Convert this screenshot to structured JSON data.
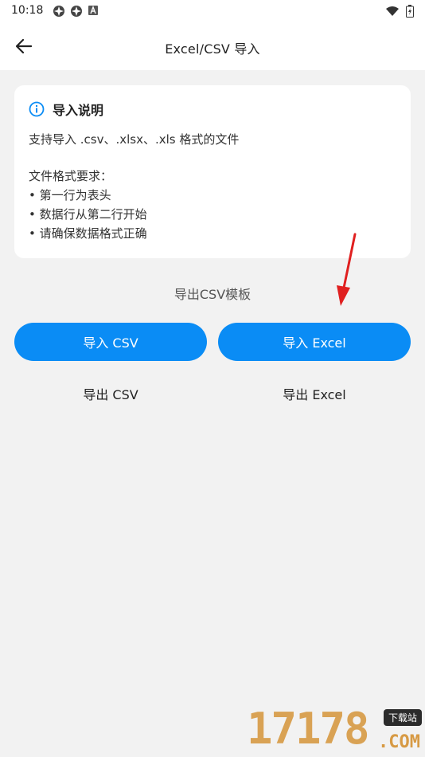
{
  "status_bar": {
    "time": "10:18",
    "left_icons": [
      "pinwheel-icon",
      "pinwheel-icon",
      "a-box-icon"
    ],
    "right_icons": [
      "wifi-icon",
      "battery-icon"
    ]
  },
  "app_bar": {
    "back_icon": "arrow-left-icon",
    "title": "Excel/CSV 导入"
  },
  "info_card": {
    "icon": "info-circle-icon",
    "title": "导入说明",
    "summary": "支持导入 .csv、.xlsx、.xls 格式的文件",
    "requirements_title": "文件格式要求：",
    "requirements": [
      "• 第一行为表头",
      "• 数据行从第二行开始",
      "• 请确保数据格式正确"
    ]
  },
  "template_link": "导出CSV模板",
  "buttons": {
    "import_csv": "导入 CSV",
    "import_excel": "导入 Excel",
    "export_csv": "导出 CSV",
    "export_excel": "导出 Excel"
  },
  "watermark": {
    "digits": "17178",
    "tag": "下载站",
    "suffix": ".COM"
  },
  "colors": {
    "primary": "#0a8cf5",
    "background": "#f2f2f2",
    "annotation_arrow": "#e02020"
  }
}
